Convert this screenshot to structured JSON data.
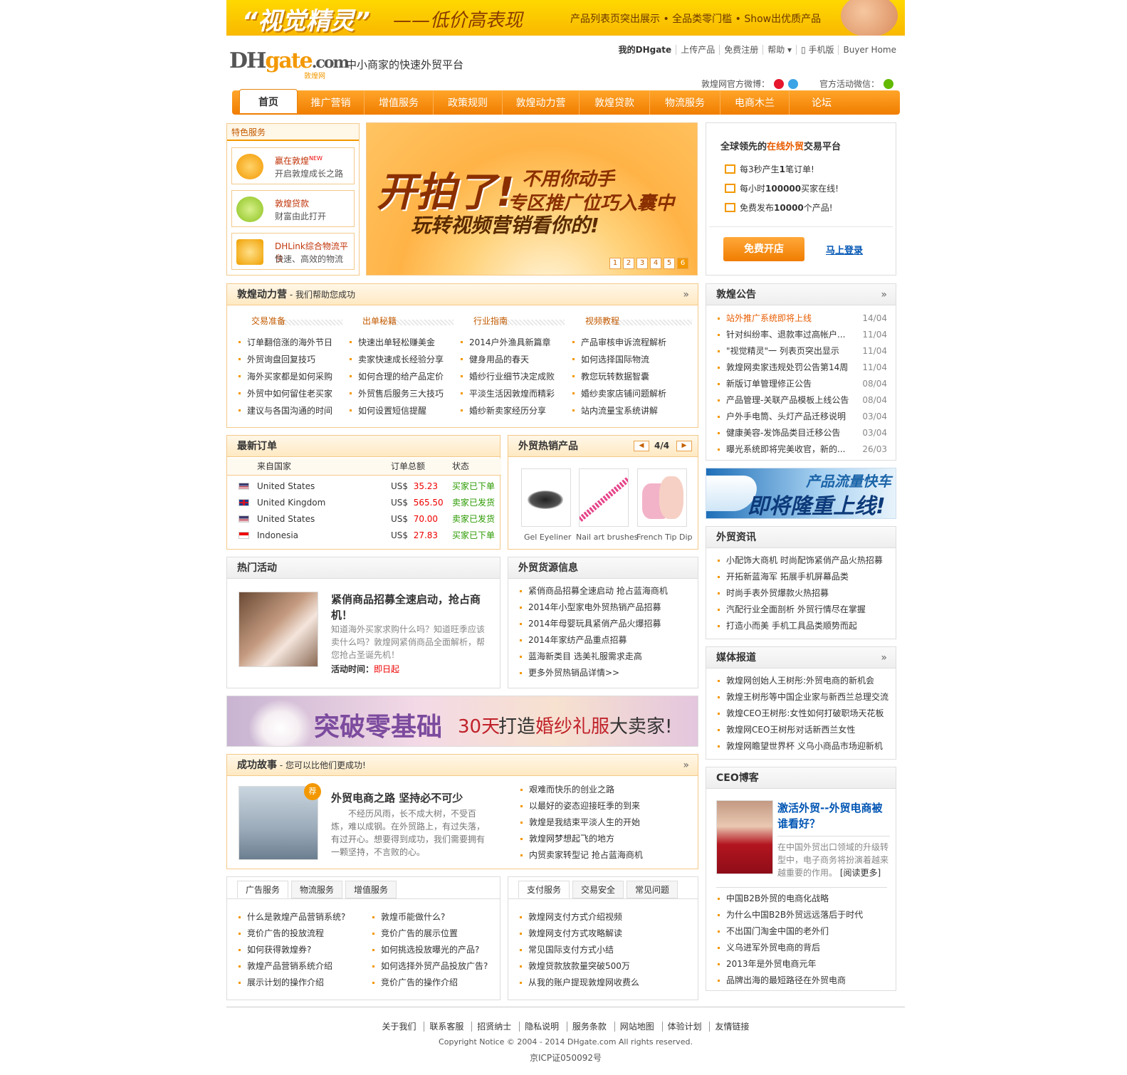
{
  "banner": {
    "title": "“视觉精灵”",
    "subtitle": "——低价高表现",
    "desc": "产品列表页突出展示 • 全品类零门槛 • Show出优质产品"
  },
  "header": {
    "logo_text": "DHgate.com",
    "logo_cn": "敦煌网",
    "slogan": "中小商家的快速外贸平台",
    "links": [
      "我的DHgate",
      "上传产品",
      "免费注册",
      "帮助 ▾",
      "▯ 手机版",
      "Buyer Home"
    ],
    "weibo_label": "敦煌网官方微博：",
    "weixin_label": "官方活动微信："
  },
  "nav": [
    "首页",
    "推广营销",
    "增值服务",
    "政策规则",
    "敦煌动力营",
    "敦煌贷款",
    "物流服务",
    "电商木兰",
    "论坛"
  ],
  "special": {
    "title": "特色服务",
    "items": [
      {
        "l1": "赢在敦煌",
        "badge": "NEW",
        "l2": "开启敦煌成长之路"
      },
      {
        "l1": "敦煌贷款",
        "l2": "财富由此打开"
      },
      {
        "l1": "DHLink综合物流平台",
        "l2": "快速、高效的物流"
      }
    ]
  },
  "slider": {
    "big": "开拍了!",
    "line1": "不用你动手",
    "line2": "专区推广位巧入囊中",
    "line3": "玩转视频营销看你的!",
    "pages": [
      "1",
      "2",
      "3",
      "4",
      "5",
      "6"
    ]
  },
  "platform": {
    "title_pre": "全球领先的",
    "title_hl": "在线外贸",
    "title_post": "交易平台",
    "checks": [
      {
        "pre": "每3秒产生",
        "num": "1",
        "post": "笔订单!"
      },
      {
        "pre": "每小时",
        "num": "100000",
        "post": "买家在线!"
      },
      {
        "pre": "免费发布",
        "num": "10000",
        "post": "个产品!"
      }
    ],
    "open_btn": "免费开店",
    "login_link": "马上登录"
  },
  "dongli": {
    "title": "敦煌动力营",
    "subtitle": " - 我们帮助您成功",
    "more": "»",
    "cols": [
      {
        "title": "交易准备",
        "items": [
          "订单翻倍涨的海外节日",
          "外贸询盘回复技巧",
          "海外买家都是如何采购",
          "外贸中如何留住老买家",
          "建议与各国沟通的时间"
        ]
      },
      {
        "title": "出单秘籍",
        "items": [
          "快速出单轻松赚美金",
          "卖家快速成长经验分享",
          "如何合理的给产品定价",
          "外贸售后服务三大技巧",
          "如何设置短信提醒"
        ]
      },
      {
        "title": "行业指南",
        "items": [
          "2014户外渔具新篇章",
          "健身用品的春天",
          "婚纱行业细节决定成败",
          "平淡生活因敦煌而精彩",
          "婚纱新卖家经历分享"
        ]
      },
      {
        "title": "视频教程",
        "items": [
          "产品审核申诉流程解析",
          "如何选择国际物流",
          "教您玩转数据智囊",
          "婚纱卖家店铺问题解析",
          "站内流量宝系统讲解"
        ]
      }
    ]
  },
  "orders": {
    "title": "最新订单",
    "headers": [
      "来自国家",
      "订单总额",
      "状态"
    ],
    "rows": [
      {
        "country": "United States",
        "cur": "US$",
        "amount": "35.23",
        "status": "买家已下单",
        "flag": "us"
      },
      {
        "country": "United Kingdom",
        "cur": "US$",
        "amount": "565.50",
        "status": "卖家已发货",
        "flag": "uk"
      },
      {
        "country": "United States",
        "cur": "US$",
        "amount": "70.00",
        "status": "卖家已发货",
        "flag": "us"
      },
      {
        "country": "Indonesia",
        "cur": "US$",
        "amount": "27.83",
        "status": "买家已下单",
        "flag": "id"
      }
    ]
  },
  "hotprod": {
    "title": "外贸热销产品",
    "page": "4/4",
    "items": [
      "Gel Eyeliner",
      "Nail art brushes",
      "French Tip Dip"
    ]
  },
  "activity": {
    "title": "热门活动",
    "headline": "紧俏商品招募全速启动，抢占商机！",
    "desc": "知道海外买家求购什么吗？知道旺季应该卖什么吗？敦煌网紧俏商品全面解析，帮您抢占圣诞先机！",
    "time_label": "活动时间：",
    "time_value": "即日起"
  },
  "source": {
    "title": "外贸货源信息",
    "items": [
      "紧俏商品招募全速启动 抢占蓝海商机",
      "2014年小型家电外贸热销产品招募",
      "2014年母婴玩具紧俏产品火爆招募",
      "2014年家纺产品重点招募",
      "蓝海新类目 选美礼服需求走高",
      "更多外贸热销品详情>>"
    ]
  },
  "wedding": {
    "w1": "突破零基础",
    "w2": "30天",
    "w3": "打造",
    "w4": "婚纱礼服",
    "w5": "大卖家!"
  },
  "success": {
    "title": "成功故事",
    "subtitle": " - 您可以比他们更成功!",
    "more": "»",
    "badge": "荐",
    "headline": "外贸电商之路 坚持必不可少",
    "desc": "不经历风雨，长不成大树，不受百炼，难以成钢。在外贸路上，有过失落，有过开心。想要得到成功，我们需要拥有一颗坚持，不言败的心。",
    "items": [
      "艰难而快乐的创业之路",
      "以最好的姿态迎接旺季的到来",
      "敦煌是我结束平淡人生的开始",
      "敦煌网梦想起飞的地方",
      "内贸卖家转型记 抢占蓝海商机"
    ]
  },
  "tabs1": {
    "tabs": [
      "广告服务",
      "物流服务",
      "增值服务"
    ],
    "left": [
      "什么是敦煌产品营销系统?",
      "竞价广告的投放流程",
      "如何获得敦煌券?",
      "敦煌产品营销系统介绍",
      "展示计划的操作介绍"
    ],
    "right": [
      "敦煌币能做什么?",
      "竞价广告的展示位置",
      "如何挑选投放曝光的产品?",
      "如何选择外贸产品投放广告?",
      "竞价广告的操作介绍"
    ]
  },
  "tabs2": {
    "tabs": [
      "支付服务",
      "交易安全",
      "常见问题"
    ],
    "items": [
      "敦煌网支付方式介绍视频",
      "敦煌网支付方式攻略解读",
      "常见国际支付方式小结",
      "敦煌贷款放款量突破500万",
      "从我的账户提现敦煌网收费么"
    ]
  },
  "notice": {
    "title": "敦煌公告",
    "more": "»",
    "items": [
      {
        "t": "站外推广系统即将上线",
        "d": "14/04",
        "hl": true
      },
      {
        "t": "针对纠纷率、退款率过高帐户...",
        "d": "11/04"
      },
      {
        "t": "\"视觉精灵\"一 列表页突出显示",
        "d": "11/04"
      },
      {
        "t": "敦煌网卖家违规处罚公告第14周",
        "d": "11/04"
      },
      {
        "t": "新版订单管理修正公告",
        "d": "08/04"
      },
      {
        "t": "产品管理-关联产品模板上线公告",
        "d": "08/04"
      },
      {
        "t": "户外手电筒、头灯产品迁移说明",
        "d": "03/04"
      },
      {
        "t": "健康美容-发饰品类目迁移公告",
        "d": "03/04"
      },
      {
        "t": "曝光系统即将完美收官，新的...",
        "d": "26/03"
      }
    ]
  },
  "railban": {
    "r1": "产品流量快车",
    "r2": "即将隆重上线!"
  },
  "news": {
    "title": "外贸资讯",
    "items": [
      "小配饰大商机 时尚配饰紧俏产品火热招募",
      "开拓新蓝海军 拓展手机屏幕品类",
      "时尚手表外贸爆款火热招募",
      "汽配行业全面剖析 外贸行情尽在掌握",
      "打造小而美 手机工具品类顺势而起"
    ]
  },
  "media": {
    "title": "媒体报道",
    "more": "»",
    "items": [
      "敦煌网创始人王树彤:外贸电商的新机会",
      "敦煌王树彤等中国企业家与新西兰总理交流",
      "敦煌CEO王树彤:女性如何打破职场天花板",
      "敦煌网CEO王树彤对话新西兰女性",
      "敦煌网瞻望世界杯 义乌小商品市场迎新机"
    ]
  },
  "ceo": {
    "title": "CEO博客",
    "headline": "激活外贸--外贸电商被谁看好？",
    "desc": "在中国外贸出口领域的升级转型中，电子商务将扮演着越来越重要的作用。",
    "read_more": "[阅读更多]",
    "items": [
      "中国B2B外贸的电商化战略",
      "为什么中国B2B外贸远远落后于时代",
      "不出国门淘金中国的老外们",
      "义乌进军外贸电商的背后",
      "2013年是外贸电商元年",
      "品牌出海的最短路径在外贸电商"
    ]
  },
  "footer": {
    "links": [
      "关于我们",
      "联系客服",
      "招贤纳士",
      "隐私说明",
      "服务条款",
      "网站地图",
      "体验计划",
      "友情链接"
    ],
    "copyright": "Copyright Notice © 2004 - 2014 DHgate.com All rights reserved.",
    "icp": "京ICP证050092号"
  }
}
